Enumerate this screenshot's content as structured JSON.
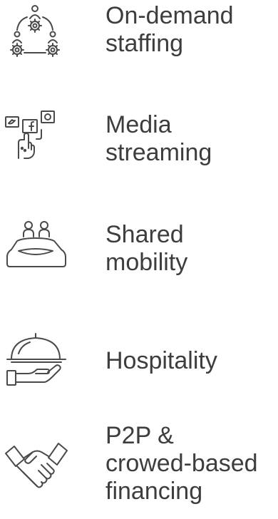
{
  "items": [
    {
      "label": "On-demand\nstaffing",
      "icon": "staffing-network-icon"
    },
    {
      "label": "Media\nstreaming",
      "icon": "social-media-streaming-icon"
    },
    {
      "label": "Shared\nmobility",
      "icon": "shared-car-icon"
    },
    {
      "label": "Hospitality",
      "icon": "serving-cloche-icon"
    },
    {
      "label": "P2P &\ncrowed-based\nfinancing",
      "icon": "handshake-icon"
    }
  ],
  "colors": {
    "text": "#3d3d3d",
    "icon_stroke": "#4a4a4a",
    "background": "#ffffff"
  }
}
